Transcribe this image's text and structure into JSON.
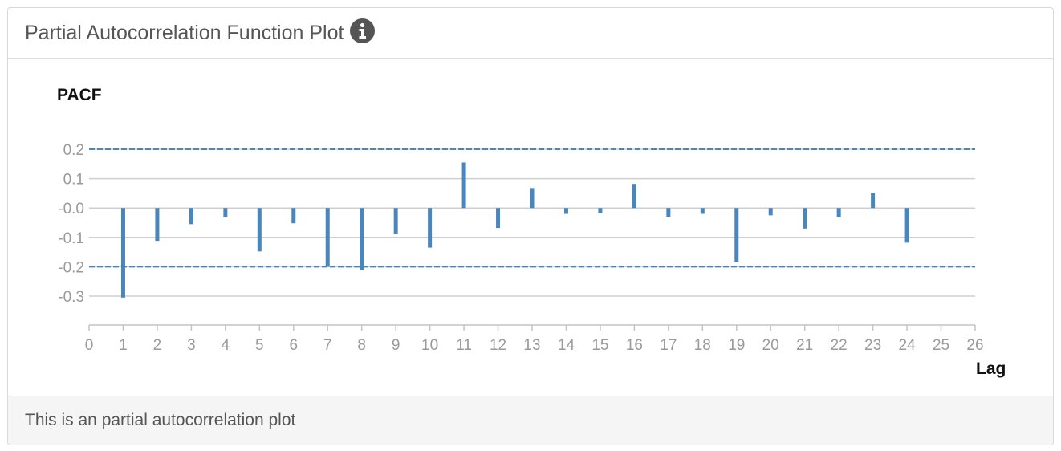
{
  "panel": {
    "title": "Partial Autocorrelation Function Plot",
    "info_icon": "info-circle-icon",
    "footer": "This is an partial autocorrelation plot"
  },
  "chart_data": {
    "type": "bar",
    "ylabel": "PACF",
    "xlabel": "Lag",
    "xlim": [
      0,
      26
    ],
    "ylim": [
      -0.3,
      0.2
    ],
    "xticks": [
      0,
      1,
      2,
      3,
      4,
      5,
      6,
      7,
      8,
      9,
      10,
      11,
      12,
      13,
      14,
      15,
      16,
      17,
      18,
      19,
      20,
      21,
      22,
      23,
      24,
      25,
      26
    ],
    "yticks": [
      {
        "value": 0.2,
        "label": "0.2"
      },
      {
        "value": 0.1,
        "label": "0.1"
      },
      {
        "value": 0.0,
        "label": "-0.0"
      },
      {
        "value": -0.1,
        "label": "-0.1"
      },
      {
        "value": -0.2,
        "label": "-0.2"
      },
      {
        "value": -0.3,
        "label": "-0.3"
      }
    ],
    "confidence_bounds": [
      0.2,
      -0.2
    ],
    "x": [
      1,
      2,
      3,
      4,
      5,
      6,
      7,
      8,
      9,
      10,
      11,
      12,
      13,
      14,
      15,
      16,
      17,
      18,
      19,
      20,
      21,
      22,
      23,
      24
    ],
    "values": [
      -0.305,
      -0.112,
      -0.055,
      -0.032,
      -0.148,
      -0.052,
      -0.2,
      -0.212,
      -0.088,
      -0.135,
      0.155,
      -0.068,
      0.068,
      -0.02,
      -0.018,
      0.082,
      -0.03,
      -0.02,
      -0.185,
      -0.025,
      -0.07,
      -0.032,
      0.052,
      -0.118
    ],
    "bar_color": "#4a86be",
    "grid": true
  }
}
